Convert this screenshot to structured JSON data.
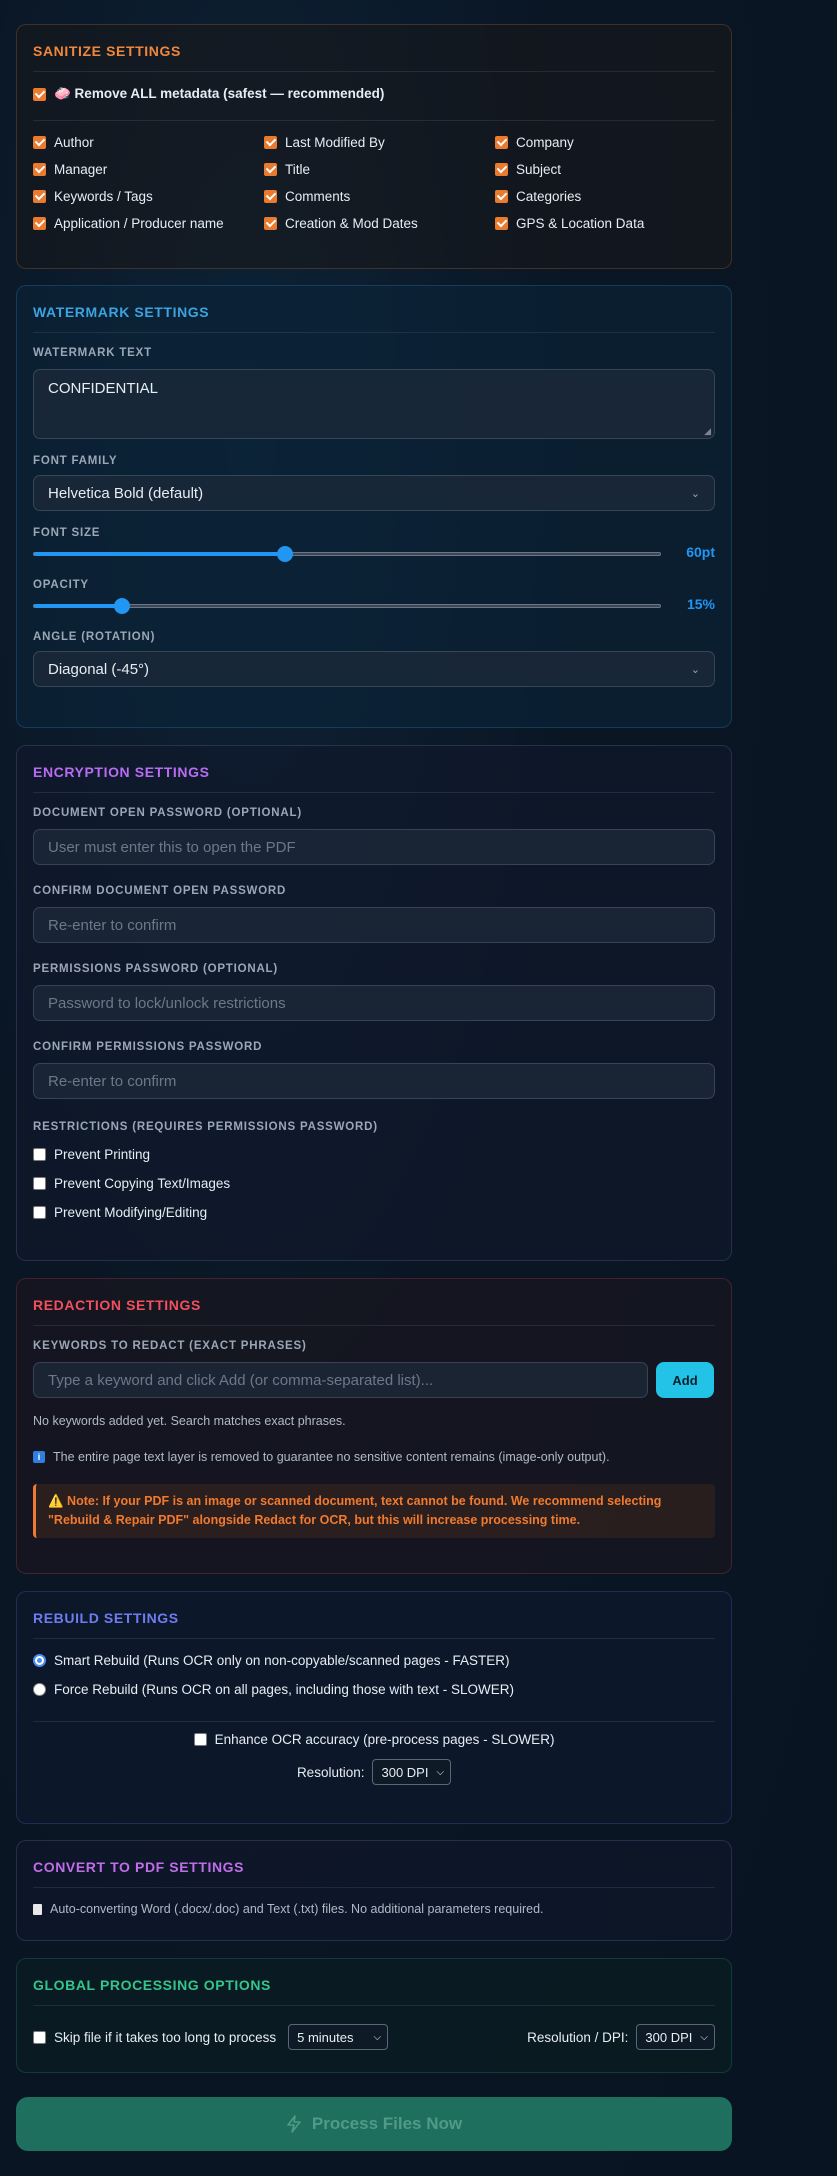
{
  "colors": {
    "sanitize": "#f0873a",
    "watermark": "#3aa3e0",
    "encryption": "#b86cf2",
    "redaction": "#f2505a",
    "rebuild": "#6f7cf0",
    "convert": "#c06ee8",
    "global": "#34c58a"
  },
  "sanitize": {
    "title": "SANITIZE SETTINGS",
    "remove_all": "🧼 Remove ALL metadata (safest — recommended)",
    "fields": [
      "Author",
      "Last Modified By",
      "Company",
      "Manager",
      "Title",
      "Subject",
      "Keywords / Tags",
      "Comments",
      "Categories",
      "Application / Producer name",
      "Creation & Mod Dates",
      "GPS & Location Data"
    ]
  },
  "watermark": {
    "title": "WATERMARK SETTINGS",
    "text_label": "WATERMARK TEXT",
    "text_value": "CONFIDENTIAL",
    "font_family_label": "FONT FAMILY",
    "font_family_value": "Helvetica Bold (default)",
    "font_size_label": "FONT SIZE",
    "font_size_value": "60pt",
    "font_size_fraction": 0.4,
    "opacity_label": "OPACITY",
    "opacity_value": "15%",
    "opacity_fraction": 0.14,
    "angle_label": "ANGLE (ROTATION)",
    "angle_value": "Diagonal (-45°)"
  },
  "encryption": {
    "title": "ENCRYPTION SETTINGS",
    "open_pw_label": "DOCUMENT OPEN PASSWORD (OPTIONAL)",
    "open_pw_placeholder": "User must enter this to open the PDF",
    "confirm_open_label": "CONFIRM DOCUMENT OPEN PASSWORD",
    "confirm_open_placeholder": "Re-enter to confirm",
    "perm_pw_label": "PERMISSIONS PASSWORD (OPTIONAL)",
    "perm_pw_placeholder": "Password to lock/unlock restrictions",
    "confirm_perm_label": "CONFIRM PERMISSIONS PASSWORD",
    "confirm_perm_placeholder": "Re-enter to confirm",
    "restrictions_label": "RESTRICTIONS (REQUIRES PERMISSIONS PASSWORD)",
    "restrictions": [
      "Prevent Printing",
      "Prevent Copying Text/Images",
      "Prevent Modifying/Editing"
    ]
  },
  "redaction": {
    "title": "REDACTION SETTINGS",
    "keywords_label": "KEYWORDS TO REDACT (EXACT PHRASES)",
    "keywords_placeholder": "Type a keyword and click Add (or comma-separated list)...",
    "add_label": "Add",
    "empty_note": "No keywords added yet. Search matches exact phrases.",
    "info_note": "The entire page text layer is removed to guarantee no sensitive content remains (image-only output).",
    "warning_line1": "⚠️ Note: If your PDF is an image or scanned document, text cannot be found. We recommend selecting",
    "warning_line2": "\"Rebuild & Repair PDF\" alongside Redact for OCR, but this will increase processing time."
  },
  "rebuild": {
    "title": "REBUILD SETTINGS",
    "smart": "Smart Rebuild (Runs OCR only on non-copyable/scanned pages - FASTER)",
    "force": "Force Rebuild (Runs OCR on all pages, including those with text - SLOWER)",
    "enhance": "Enhance OCR accuracy (pre-process pages - SLOWER)",
    "resolution_label": "Resolution:",
    "resolution_value": "300 DPI"
  },
  "convert": {
    "title": "CONVERT TO PDF SETTINGS",
    "note": "Auto-converting Word (.docx/.doc) and Text (.txt) files. No additional parameters required."
  },
  "global": {
    "title": "GLOBAL PROCESSING OPTIONS",
    "skip_label": "Skip file if it takes too long to process",
    "timeout_value": "5 minutes",
    "dpi_label": "Resolution / DPI:",
    "dpi_value": "300 DPI"
  },
  "process_button": "Process Files Now"
}
